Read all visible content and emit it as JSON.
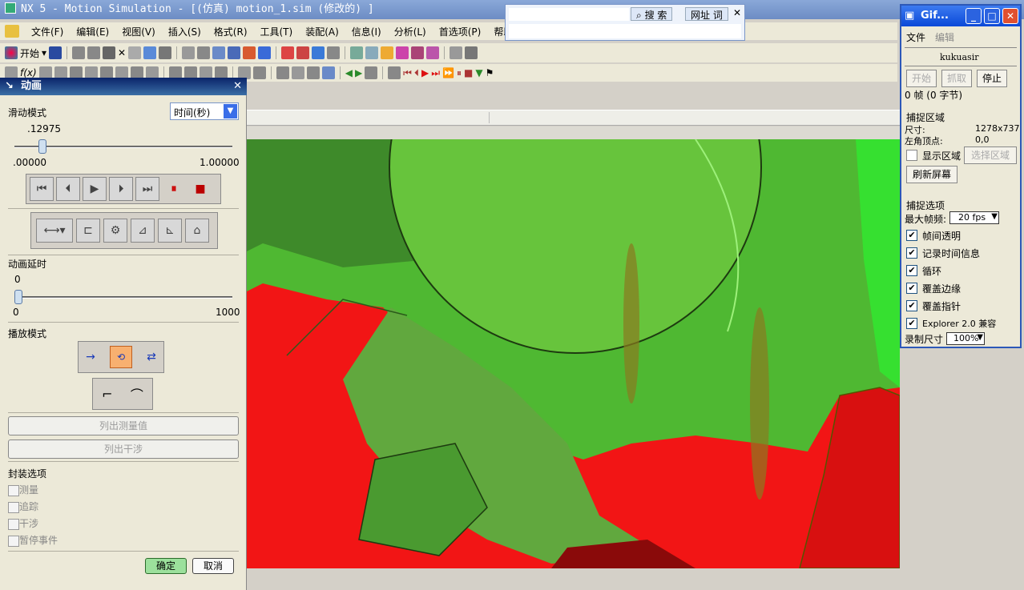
{
  "app": {
    "title": "NX 5 - Motion Simulation - [(仿真) motion_1.sim (修改的) ]"
  },
  "search": {
    "search_label": "搜 索",
    "site_label": "网址 词"
  },
  "menu": [
    "文件(F)",
    "编辑(E)",
    "视图(V)",
    "插入(S)",
    "格式(R)",
    "工具(T)",
    "装配(A)",
    "信息(I)",
    "分析(L)",
    "首选项(P)",
    "帮助(H)"
  ],
  "toolbar": {
    "start_label": "开始"
  },
  "panel": {
    "title": "动画",
    "slide_mode_label": "滑动模式",
    "slide_mode_value": "时间(秒)",
    "time_value": ".12975",
    "time_min": ".00000",
    "time_max": "1.00000",
    "time_fraction": 0.12975,
    "delay_label": "动画延时",
    "delay_value": "0",
    "delay_min": "0",
    "delay_max": "1000",
    "play_mode_label": "播放模式",
    "list_measurements": "列出测量值",
    "list_interference": "列出干涉",
    "package_label": "封装选项",
    "package_options": [
      "测量",
      "追踪",
      "干涉",
      "暂停事件"
    ],
    "ok": "确定",
    "cancel": "取消"
  },
  "gif": {
    "title": "Gif...",
    "menu_file": "文件",
    "menu_edit": "编辑",
    "user": "kukuasir",
    "btn_start": "开始",
    "btn_capture": "抓取",
    "btn_stop": "停止",
    "status": "0 帧 (0 字节)",
    "capture_area_label": "捕捉区域",
    "size_label": "尺寸:",
    "size_value": "1278x737",
    "origin_label": "左角顶点:",
    "origin_value": "0,0",
    "show_area": "显示区域",
    "select_area": "选择区域",
    "refresh": "刷新屏幕",
    "options_label": "捕捉选项",
    "max_fps_label": "最大帧频:",
    "max_fps_value": "20 fps",
    "options": [
      "帧间透明",
      "记录时间信息",
      "循环",
      "覆盖边缘",
      "覆盖指针",
      "Explorer 2.0 兼容"
    ],
    "record_size_label": "录制尺寸",
    "record_size_value": "100%"
  },
  "colors": {
    "accent": "#3a6ea5",
    "gear_green": "#5ec83a",
    "gear_red": "#f01010"
  }
}
